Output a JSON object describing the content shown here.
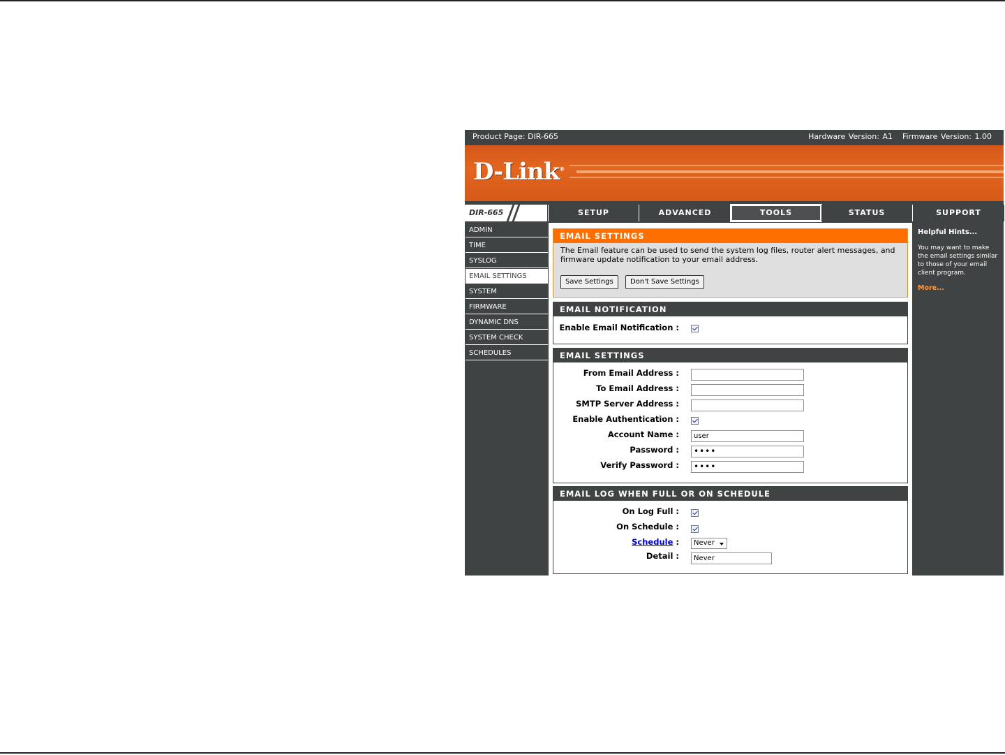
{
  "header": {
    "product_page": "Product Page: DIR-665",
    "hardware_version": "Hardware Version: A1",
    "firmware_version": "Firmware Version: 1.00"
  },
  "brand": {
    "logo": "D-Link",
    "registered": "®"
  },
  "model": "DIR-665",
  "tabs": [
    {
      "label": "SETUP",
      "active": false
    },
    {
      "label": "ADVANCED",
      "active": false
    },
    {
      "label": "TOOLS",
      "active": true
    },
    {
      "label": "STATUS",
      "active": false
    },
    {
      "label": "SUPPORT",
      "active": false
    }
  ],
  "sidebar": {
    "items": [
      {
        "label": "ADMIN"
      },
      {
        "label": "TIME"
      },
      {
        "label": "SYSLOG"
      },
      {
        "label": "EMAIL SETTINGS",
        "active": true
      },
      {
        "label": "SYSTEM"
      },
      {
        "label": "FIRMWARE"
      },
      {
        "label": "DYNAMIC DNS"
      },
      {
        "label": "SYSTEM CHECK"
      },
      {
        "label": "SCHEDULES"
      }
    ]
  },
  "intro": {
    "title": "EMAIL SETTINGS",
    "description": "The Email feature can be used to send the system log files, router alert messages, and firmware update notification to your email address.",
    "save_label": "Save Settings",
    "dont_save_label": "Don't Save Settings"
  },
  "notification": {
    "title": "EMAIL NOTIFICATION",
    "enable_label": "Enable Email Notification :",
    "enable_checked": true
  },
  "settings": {
    "title": "EMAIL SETTINGS",
    "from_label": "From Email Address :",
    "from_value": "",
    "to_label": "To Email Address :",
    "to_value": "",
    "smtp_label": "SMTP Server Address :",
    "smtp_value": "",
    "auth_label": "Enable Authentication :",
    "auth_checked": true,
    "account_label": "Account Name :",
    "account_value": "user",
    "password_label": "Password :",
    "password_value": "••••",
    "verify_label": "Verify Password :",
    "verify_value": "••••"
  },
  "log": {
    "title": "EMAIL LOG WHEN FULL OR ON SCHEDULE",
    "log_full_label": "On Log Full :",
    "log_full_checked": true,
    "on_schedule_label": "On Schedule :",
    "on_schedule_checked": true,
    "schedule_link": "Schedule",
    "schedule_colon": ":",
    "schedule_value": "Never",
    "detail_label": "Detail :",
    "detail_value": "Never"
  },
  "hints": {
    "title": "Helpful Hints...",
    "text": "You may want to make the email settings similar to those of your email client program.",
    "more": "More..."
  },
  "colors": {
    "dark_gray": "#404343",
    "orange_header": "#ff6f00",
    "banner_orange": "#e2661f",
    "link_orange": "#ff9a40"
  }
}
